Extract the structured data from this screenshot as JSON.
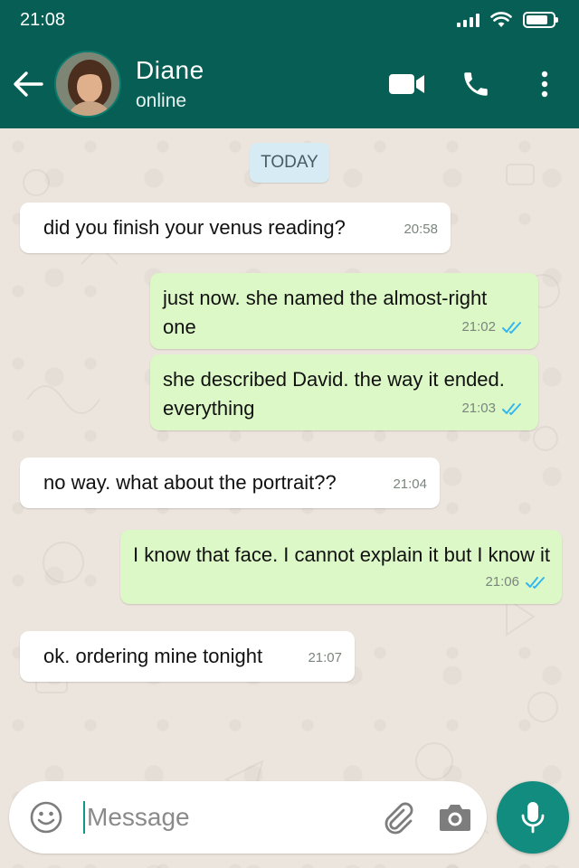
{
  "status_bar": {
    "time": "21:08",
    "icons": [
      "signal-icon",
      "wifi-icon",
      "battery-icon"
    ]
  },
  "header": {
    "contact_name": "Diane",
    "contact_status": "online",
    "actions": [
      "video-call-icon",
      "phone-icon",
      "more-options-icon"
    ]
  },
  "chat": {
    "date_chip": "TODAY",
    "messages": [
      {
        "direction": "incoming",
        "lines": [
          "did you finish your venus reading?"
        ],
        "time": "20:58"
      },
      {
        "direction": "outgoing",
        "lines": [
          "just now. she named the almost-right",
          "one"
        ],
        "time": "21:02",
        "status": "read"
      },
      {
        "direction": "outgoing",
        "lines": [
          "she described David. the way it ended.",
          "everything"
        ],
        "time": "21:03",
        "status": "read"
      },
      {
        "direction": "incoming",
        "lines": [
          "no way. what about the portrait??"
        ],
        "time": "21:04"
      },
      {
        "direction": "outgoing",
        "lines": [
          "I know that face. I cannot explain it but I know it"
        ],
        "time": "21:06",
        "status": "read"
      },
      {
        "direction": "incoming",
        "lines": [
          "ok. ordering mine tonight"
        ],
        "time": "21:07"
      }
    ]
  },
  "composer": {
    "placeholder": "Message",
    "value": ""
  },
  "colors": {
    "header": "#075e54",
    "outgoing_bubble": "#dcf8c6",
    "incoming_bubble": "#ffffff",
    "read_ticks": "#34b7f1",
    "mic_button": "#128c7e",
    "date_chip": "#d6ebf3"
  }
}
